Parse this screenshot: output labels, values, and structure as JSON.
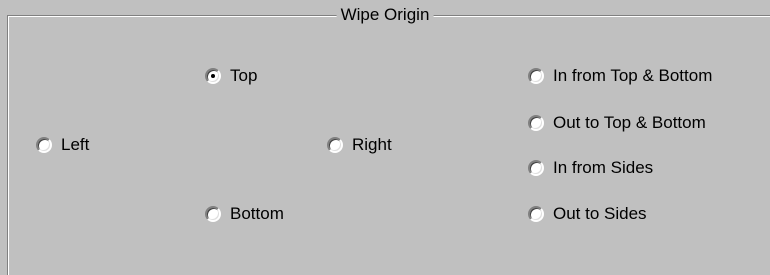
{
  "group": {
    "title": "Wipe Origin"
  },
  "options": {
    "left": {
      "label": "Left",
      "selected": false
    },
    "top": {
      "label": "Top",
      "selected": true
    },
    "right": {
      "label": "Right",
      "selected": false
    },
    "bottom": {
      "label": "Bottom",
      "selected": false
    },
    "in_top_bottom": {
      "label": "In from Top & Bottom",
      "selected": false
    },
    "out_top_bottom": {
      "label": "Out to Top & Bottom",
      "selected": false
    },
    "in_sides": {
      "label": "In from Sides",
      "selected": false
    },
    "out_sides": {
      "label": "Out to Sides",
      "selected": false
    }
  },
  "colors": {
    "background": "#c0c0c0",
    "shadow": "#808080",
    "highlight": "#ffffff"
  }
}
